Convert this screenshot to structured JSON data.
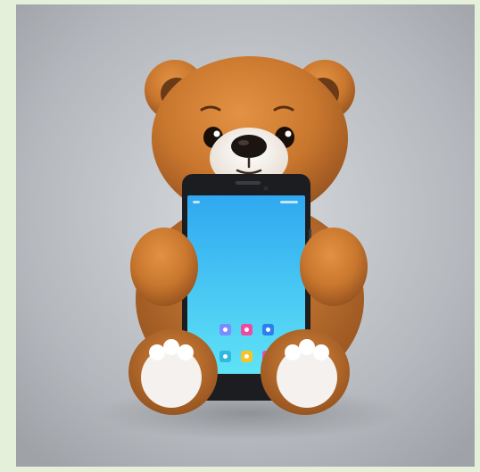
{
  "scene": {
    "subject": "teddy-bear-holding-smartphone",
    "colors": {
      "frame_background": "#e4f0da",
      "studio_background": "#b7bbc0",
      "fur": "#c9772e",
      "fur_dark": "#9a5520",
      "muzzle": "#f3ece4",
      "paw_pad": "#f4f1ee",
      "phone_body": "#1c1d21",
      "screen_top": "#2fa8f0",
      "screen_bottom": "#5fe3f6"
    },
    "phone": {
      "home_icons": [
        {
          "icon": "gallery-icon",
          "color": "#7c8cff"
        },
        {
          "icon": "app-icon",
          "color": "#f04aa0"
        },
        {
          "icon": "share-icon",
          "color": "#2d7ff0"
        },
        {
          "icon": "settings-icon",
          "color": "#2fb8e0"
        },
        {
          "icon": "grid-icon",
          "color": "#f7c22a"
        },
        {
          "icon": "store-icon",
          "color": "#e24fb8"
        }
      ]
    }
  }
}
